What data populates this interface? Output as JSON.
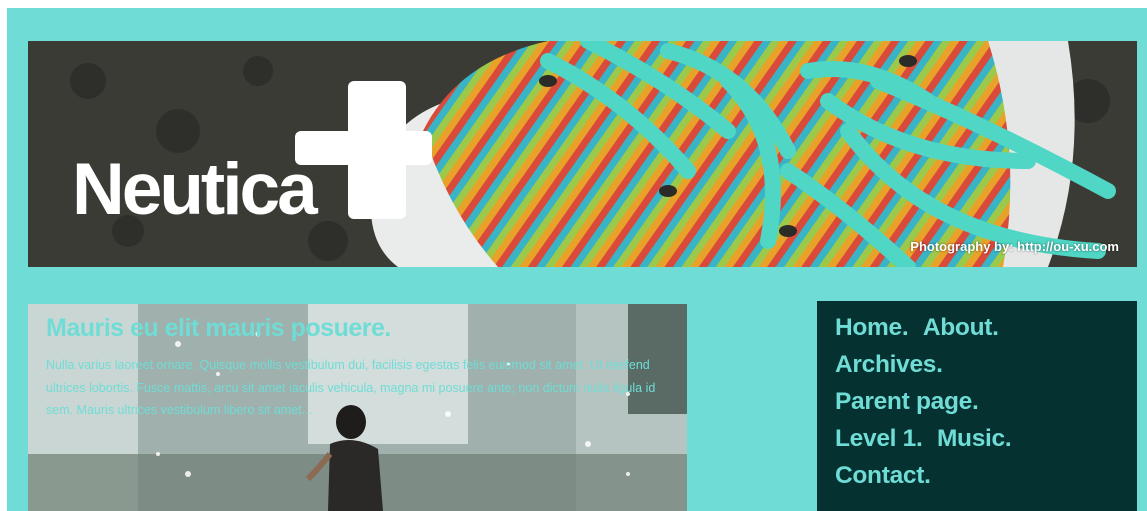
{
  "header": {
    "logo_text": "Neutica",
    "logo_icon": "plus-icon",
    "photo_credit": "Photography by: http://ou-xu.com"
  },
  "feature_post": {
    "title": "Mauris eu elit mauris posuere.",
    "excerpt": "Nulla varius laoreet ornare. Quisque mollis vestibulum dui, facilisis egestas felis euismod sit amet. Ut eleifend ultrices lobortis. Fusce mattis, arcu sit amet iaculis vehicula, magna mi posuere ante; non dictum nulla ligula id sem. Mauris ultrices vestibulum libero sit amet..."
  },
  "menu": {
    "rows": [
      [
        {
          "label": "Home."
        },
        {
          "label": "About."
        }
      ],
      [
        {
          "label": "Archives."
        }
      ],
      [
        {
          "label": "Parent page."
        }
      ],
      [
        {
          "label": "Level 1."
        },
        {
          "label": "Music."
        }
      ],
      [
        {
          "label": "Contact."
        }
      ]
    ]
  },
  "colors": {
    "page_background": "#6fddd6",
    "menu_background": "#053131",
    "accent_text": "#6fddd6"
  }
}
